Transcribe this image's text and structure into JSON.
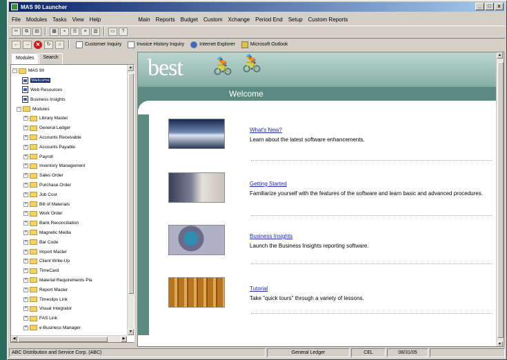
{
  "window": {
    "title": "MAS 90 Launcher",
    "buttons": [
      "_",
      "□",
      "x"
    ]
  },
  "menus_left": [
    "File",
    "Modules",
    "Tasks",
    "View",
    "Help"
  ],
  "menus_right": [
    "Main",
    "Reports",
    "Budget",
    "Custom",
    "Xchange",
    "Period End",
    "Setup",
    "Custom Reports"
  ],
  "quicklinks": [
    "Customer Inquiry",
    "Invoice History Inquiry",
    "Internet Explorer",
    "Microsoft Outlook"
  ],
  "tabs": [
    "Modules",
    "Search"
  ],
  "tree": {
    "root": "MAS 90",
    "top_items": [
      "Welcome",
      "Web Resources",
      "Business Insights"
    ],
    "modules_label": "Modules",
    "modules": [
      "Library Master",
      "General Ledger",
      "Accounts Receivable",
      "Accounts Payable",
      "Payroll",
      "Inventory Management",
      "Sales Order",
      "Purchase Order",
      "Job Cost",
      "Bill of Materials",
      "Work Order",
      "Bank Reconciliation",
      "Magnetic Media",
      "Bar Code",
      "Import Master",
      "Client Write-Up",
      "TimeCard",
      "Material Requirements Pla",
      "Report Master",
      "Timeslips Link",
      "Visual Integrator",
      "FAS Link",
      "e-Business Manager"
    ]
  },
  "banner": {
    "logo": "best",
    "heading": "Welcome"
  },
  "items": [
    {
      "title": "What's New?",
      "desc": "Learn about the latest software enhancements."
    },
    {
      "title": "Getting Started",
      "desc": "Familiarize yourself with the features of the software and learn basic and advanced procedures."
    },
    {
      "title": "Business Insights",
      "desc": "Launch the Business Insights reporting software."
    },
    {
      "title": "Tutorial",
      "desc": "Take \"quick tours\" through a variety of lessons."
    }
  ],
  "status": {
    "company": "ABC Distribution and Service Corp. (ABC)",
    "module": "General Ledger",
    "user": "CEL",
    "date": "08/31/05"
  }
}
